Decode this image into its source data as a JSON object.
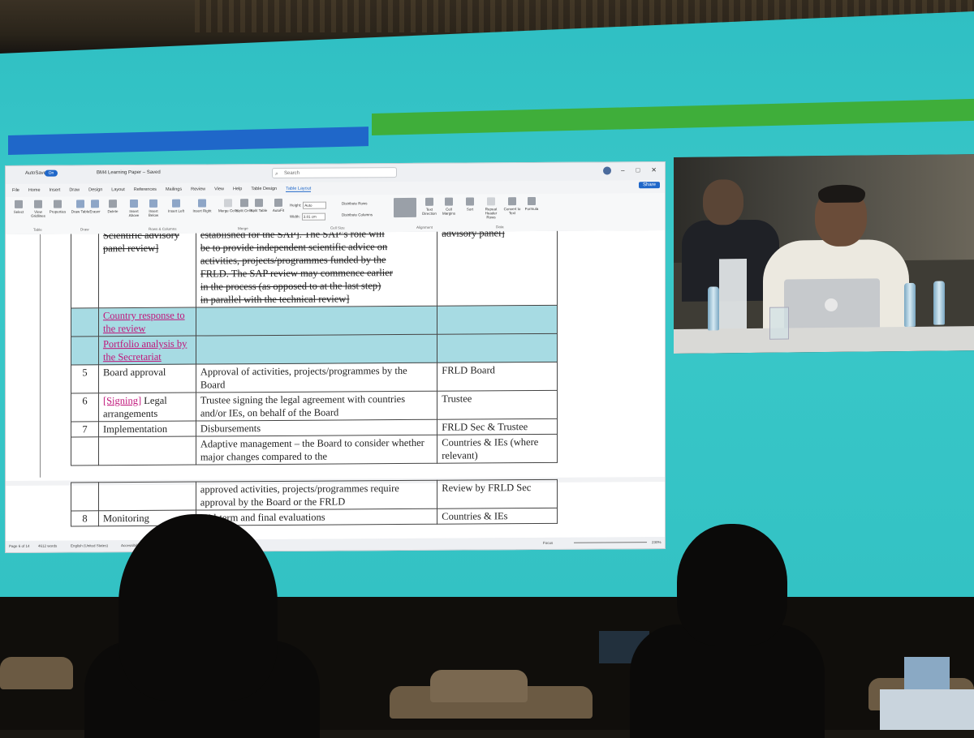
{
  "word_window": {
    "title": "BM4 Learning Paper – Saved",
    "autosave_label": "AutoSave",
    "autosave_state": "On",
    "search_placeholder": "Search",
    "share_label": "Share",
    "ribbon_tabs": [
      "File",
      "Home",
      "Insert",
      "Draw",
      "Design",
      "Layout",
      "References",
      "Mailings",
      "Review",
      "View",
      "Help",
      "Table Design",
      "Table Layout"
    ],
    "active_tab": "Table Layout",
    "ribbon": {
      "select": "Select",
      "view_gridlines": "View Gridlines",
      "properties": "Properties",
      "draw_table": "Draw Table",
      "eraser": "Eraser",
      "delete": "Delete",
      "insert_above": "Insert Above",
      "insert_below": "Insert Below",
      "insert_left": "Insert Left",
      "insert_right": "Insert Right",
      "merge_cells": "Merge Cells",
      "split_cells": "Split Cells",
      "split_table": "Split Table",
      "autofit": "AutoFit",
      "height_label": "Height:",
      "height_value": "Auto",
      "width_label": "Width:",
      "width_value": "3.81 cm",
      "distribute_rows": "Distribute Rows",
      "distribute_columns": "Distribute Columns",
      "text_direction": "Text Direction",
      "cell_margins": "Cell Margins",
      "sort": "Sort",
      "repeat_header_rows": "Repeat Header Rows",
      "convert_to_text": "Convert to Text",
      "formula": "Formula",
      "group_table": "Table",
      "group_draw": "Draw",
      "group_rows_columns": "Rows & Columns",
      "group_merge": "Merge",
      "group_cell_size": "Cell Size",
      "group_alignment": "Alignment",
      "group_data": "Data"
    },
    "status": {
      "page": "Page 6 of 14",
      "words": "4612 words",
      "language": "English (United States)",
      "accessibility": "Accessibility",
      "focus": "Focus",
      "zoom": "230%"
    }
  },
  "document": {
    "top_fragment_col2": "Scientific advisory panel review]",
    "top_fragment_col3_lines": [
      "established for the SAP]. The SAP’s role will",
      "be to provide independent scientific advice on",
      "activities, projects/programmes funded by the",
      "FRLD. The SAP review may commence earlier",
      "in the process (as opposed to at the last step)",
      "in parallel with the technical review]"
    ],
    "top_fragment_col4": "advisory panel]",
    "rows": [
      {
        "num": "",
        "step": "Country response to the review",
        "desc": "",
        "resp": "",
        "highlight": true,
        "pink": true
      },
      {
        "num": "",
        "step": "Portfolio analysis by the Secretariat",
        "desc": "",
        "resp": "",
        "highlight": true,
        "pink": true
      },
      {
        "num": "5",
        "step": "Board approval",
        "desc": "Approval of activities, projects/programmes by the Board",
        "resp": "FRLD Board"
      },
      {
        "num": "6",
        "step_pink": "[Signing]",
        "step": " Legal arrangements",
        "desc": "Trustee signing the legal agreement with countries and/or IEs, on behalf of the Board",
        "resp": "Trustee"
      },
      {
        "num": "7",
        "step": "Implementation",
        "desc": "Disbursements",
        "resp": "FRLD Sec & Trustee"
      },
      {
        "num": "",
        "step": "",
        "desc": "Adaptive management – the Board to consider whether major changes compared to the",
        "resp": "Countries & IEs (where relevant)"
      }
    ],
    "page2_rows": [
      {
        "num": "",
        "step": "",
        "desc": "approved activities, projects/programmes require approval by the Board or the FRLD",
        "resp": "Review by FRLD Sec"
      },
      {
        "num": "8",
        "step": "Monitoring",
        "desc": "mid-term and final evaluations",
        "resp": "Countries & IEs"
      }
    ]
  }
}
